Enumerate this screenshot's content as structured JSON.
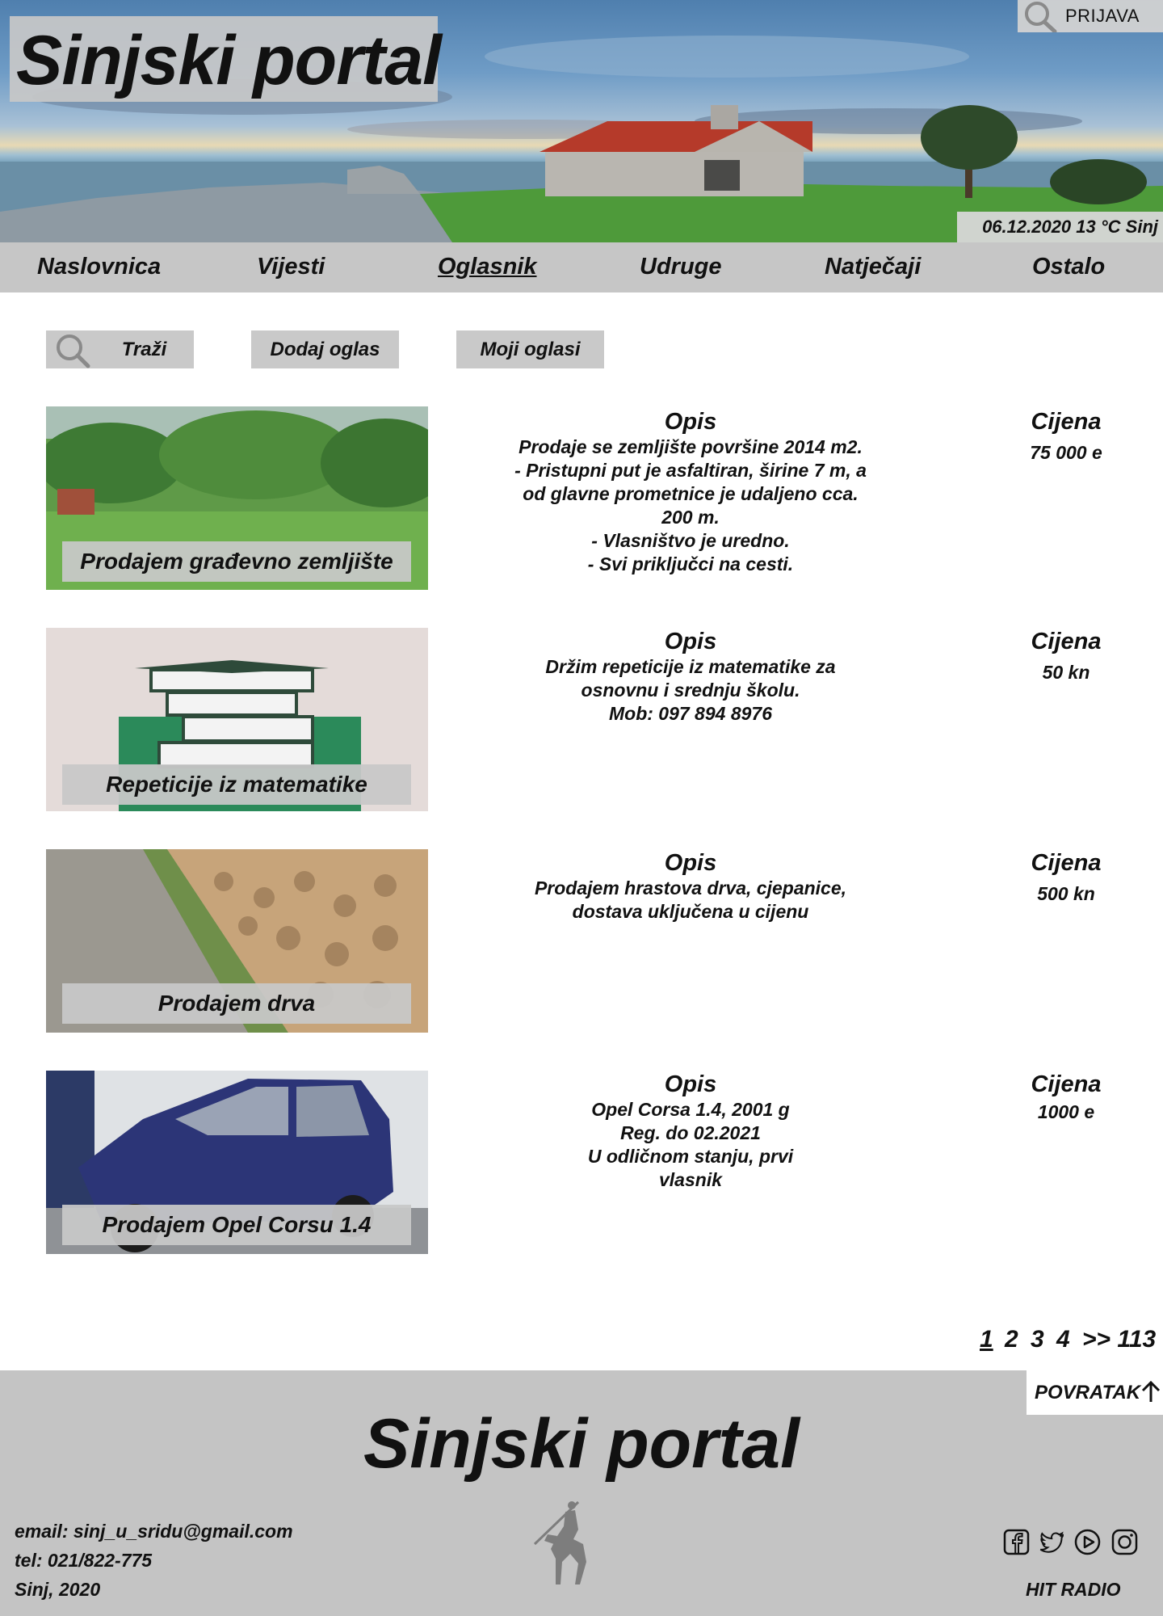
{
  "header": {
    "site_title": "Sinjski portal",
    "login_label": "PRIJAVA",
    "date_weather": "06.12.2020  13 °C Sinj"
  },
  "nav": [
    {
      "label": "Naslovnica"
    },
    {
      "label": "Vijesti"
    },
    {
      "label": "Oglasnik",
      "active": true
    },
    {
      "label": "Udruge"
    },
    {
      "label": "Natječaji"
    },
    {
      "label": "Ostalo"
    }
  ],
  "toolbar": {
    "search_label": "Traži",
    "add_label": "Dodaj oglas",
    "my_ads_label": "Moji oglasi"
  },
  "listings": [
    {
      "title": "Prodajem građevno zemljište",
      "desc_heading": "Opis",
      "description": "Prodaje se zemljište površine 2014 m2.\n - Pristupni put je asfaltiran, širine 7 m, a\nod glavne prometnice je udaljeno cca.\n200 m.\n- Vlasništvo je uredno.\n- Svi priključci na cesti.",
      "price_heading": "Cijena",
      "price": "75 000 e"
    },
    {
      "title": "Repeticije iz matematike",
      "desc_heading": "Opis",
      "description": "Držim repeticije iz matematike za\nosnovnu i srednju školu.\nMob: 097 894 8976",
      "price_heading": "Cijena",
      "price": "50 kn"
    },
    {
      "title": "Prodajem drva",
      "desc_heading": "Opis",
      "description": "Prodajem hrastova drva, cjepanice,\ndostava uključena u cijenu",
      "price_heading": "Cijena",
      "price": "500 kn"
    },
    {
      "title": "Prodajem Opel Corsu 1.4",
      "desc_heading": "Opis",
      "description": "Opel Corsa 1.4, 2001 g\nReg. do 02.2021\nU odličnom stanju, prvi\nvlasnik",
      "price_heading": "Cijena",
      "price": "1000 e"
    }
  ],
  "pagination": {
    "pages": [
      "1",
      "2",
      "3",
      "4"
    ],
    "current": "1",
    "next_last": ">> 113"
  },
  "footer": {
    "back_label": "POVRATAK",
    "site_title": "Sinjski portal",
    "email": "email: sinj_u_sridu@gmail.com",
    "phone": "tel: 021/822-775",
    "place_year": "Sinj, 2020",
    "radio_label": "HIT RADIO",
    "social_icons": [
      "facebook-icon",
      "twitter-icon",
      "youtube-icon",
      "instagram-icon"
    ]
  },
  "icons": {
    "search": "search-icon",
    "arrow_up": "arrow-up-icon",
    "emblem": "alkar-emblem-icon"
  }
}
